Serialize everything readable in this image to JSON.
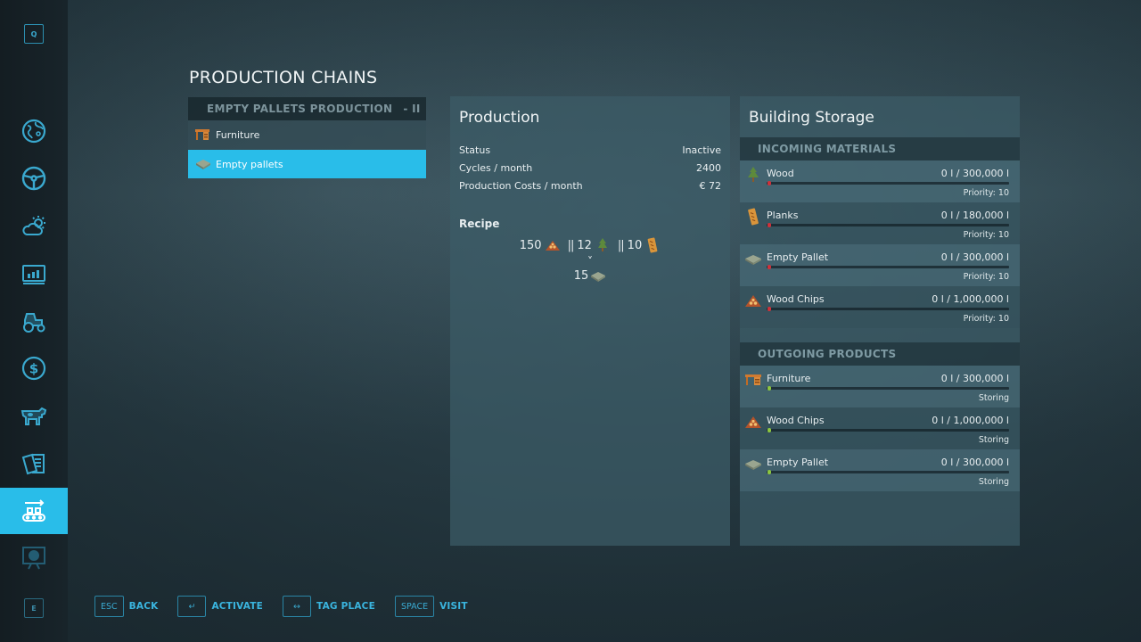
{
  "sidebar": {
    "top_key": "Q",
    "bottom_key": "E",
    "items": [
      {
        "icon": "map-globe-icon"
      },
      {
        "icon": "steering-wheel-icon"
      },
      {
        "icon": "weather-icon"
      },
      {
        "icon": "statistics-icon"
      },
      {
        "icon": "tractor-icon"
      },
      {
        "icon": "finance-dollar-icon"
      },
      {
        "icon": "animals-cow-icon"
      },
      {
        "icon": "contracts-icon"
      },
      {
        "icon": "production-chains-icon",
        "active": true
      },
      {
        "icon": "tour-presentation-icon"
      }
    ],
    "colors": {
      "accent": "#29bde9",
      "icon": "#3aa9cf"
    }
  },
  "page": {
    "title": "PRODUCTION CHAINS"
  },
  "chains": {
    "header": "EMPTY PALLETS PRODUCTION",
    "header_suffix": "- II",
    "items": [
      {
        "label": "Furniture",
        "icon": "furniture-icon",
        "selected": false
      },
      {
        "label": "Empty pallets",
        "icon": "pallet-icon",
        "selected": true
      }
    ]
  },
  "production": {
    "title": "Production",
    "rows": [
      {
        "label": "Status",
        "value": "Inactive"
      },
      {
        "label": "Cycles / month",
        "value": "2400"
      },
      {
        "label": "Production Costs / month",
        "value": "€ 72"
      }
    ],
    "recipe_label": "Recipe",
    "recipe_inputs": [
      {
        "amount": "150",
        "icon": "wood-chips-icon"
      },
      {
        "amount": "12",
        "icon": "wood-tree-icon"
      },
      {
        "amount": "10",
        "icon": "planks-icon"
      }
    ],
    "recipe_separator": "||",
    "recipe_arrow": "˅",
    "recipe_output": {
      "amount": "15",
      "icon": "pallet-icon"
    }
  },
  "storage": {
    "title": "Building Storage",
    "incoming_label": "INCOMING MATERIALS",
    "incoming": [
      {
        "name": "Wood",
        "amount": "0 l / 300,000 l",
        "sub": "Priority: 10",
        "icon": "wood-tree-icon",
        "fill_pct": 0
      },
      {
        "name": "Planks",
        "amount": "0 l / 180,000 l",
        "sub": "Priority: 10",
        "icon": "planks-icon",
        "fill_pct": 0
      },
      {
        "name": "Empty Pallet",
        "amount": "0 l / 300,000 l",
        "sub": "Priority: 10",
        "icon": "pallet-icon",
        "fill_pct": 0
      },
      {
        "name": "Wood Chips",
        "amount": "0 l / 1,000,000 l",
        "sub": "Priority: 10",
        "icon": "wood-chips-icon",
        "fill_pct": 0
      }
    ],
    "outgoing_label": "OUTGOING PRODUCTS",
    "outgoing": [
      {
        "name": "Furniture",
        "amount": "0 l / 300,000 l",
        "sub": "Storing",
        "icon": "furniture-icon",
        "fill_pct": 0
      },
      {
        "name": "Wood Chips",
        "amount": "0 l / 1,000,000 l",
        "sub": "Storing",
        "icon": "wood-chips-icon",
        "fill_pct": 0
      },
      {
        "name": "Empty Pallet",
        "amount": "0 l / 300,000 l",
        "sub": "Storing",
        "icon": "pallet-icon",
        "fill_pct": 0
      }
    ],
    "colors": {
      "incoming_indicator": "#d0313a",
      "outgoing_indicator": "#8dc63f"
    }
  },
  "footer": {
    "buttons": [
      {
        "key": "ESC",
        "label": "BACK"
      },
      {
        "key": "↵",
        "label": "ACTIVATE"
      },
      {
        "key": "↔",
        "label": "TAG PLACE"
      },
      {
        "key": "SPACE",
        "label": "VISIT"
      }
    ]
  }
}
